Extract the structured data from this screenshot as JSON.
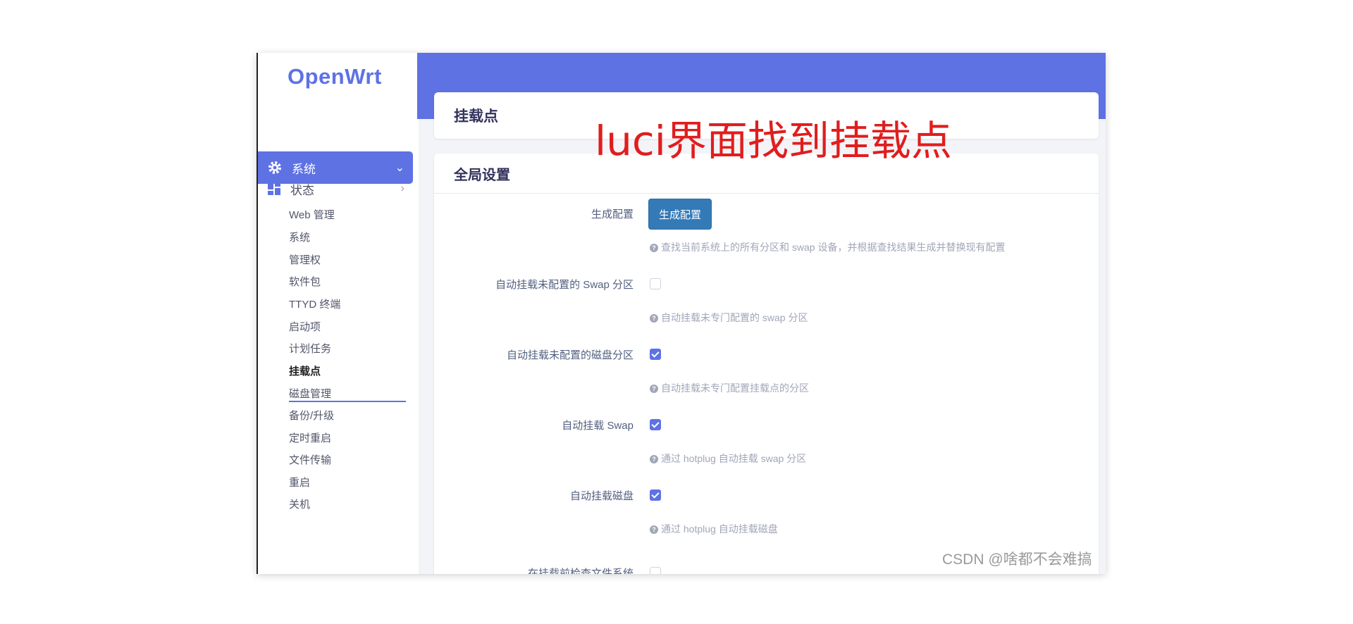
{
  "brand": "OpenWrt",
  "nav": {
    "status_label": "状态",
    "system_label": "系统",
    "sub_items": [
      "Web 管理",
      "系统",
      "管理权",
      "软件包",
      "TTYD 终端",
      "启动项",
      "计划任务",
      "挂载点",
      "磁盘管理",
      "备份/升级",
      "定时重启",
      "文件传输",
      "重启",
      "关机"
    ]
  },
  "page_title": "挂载点",
  "section_title": "全局设置",
  "rows": {
    "generate": {
      "label": "生成配置",
      "button": "生成配置",
      "hint": "查找当前系统上的所有分区和 swap 设备，并根据查找结果生成并替换现有配置"
    },
    "auto_swap_unconfigured": {
      "label": "自动挂载未配置的 Swap 分区",
      "hint": "自动挂载未专门配置的 swap 分区",
      "checked": false
    },
    "auto_mount_unconfigured": {
      "label": "自动挂载未配置的磁盘分区",
      "hint": "自动挂载未专门配置挂载点的分区",
      "checked": true
    },
    "auto_swap": {
      "label": "自动挂载 Swap",
      "hint": "通过 hotplug 自动挂载 swap 分区",
      "checked": true
    },
    "auto_mount": {
      "label": "自动挂载磁盘",
      "hint": "通过 hotplug 自动挂载磁盘",
      "checked": true
    },
    "check_fs": {
      "label": "在挂载前检查文件系统",
      "checked": false
    }
  },
  "annotation": "luci界面找到挂载点",
  "watermark": "CSDN @啥都不会难搞",
  "colors": {
    "accent": "#5e72e4",
    "button": "#337ab7",
    "annotation": "#e11d1d"
  },
  "icons": {
    "status": "dashboard-icon",
    "system": "gear-icon",
    "collapsed": "chevron-right-icon",
    "expanded": "chevron-down-icon",
    "hint": "question-circle-icon"
  }
}
